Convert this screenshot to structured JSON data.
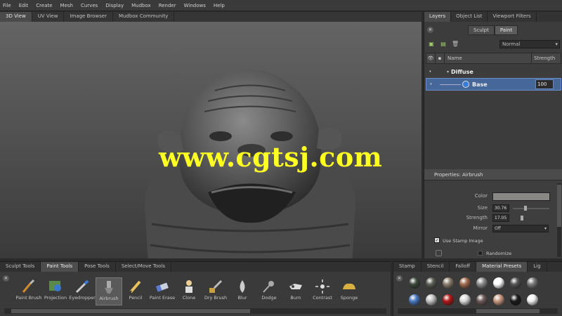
{
  "menu": [
    "File",
    "Edit",
    "Create",
    "Mesh",
    "Curves",
    "Display",
    "Mudbox",
    "Render",
    "Windows",
    "Help"
  ],
  "viewport_tabs": [
    {
      "label": "3D View",
      "active": true
    },
    {
      "label": "UV View",
      "active": false
    },
    {
      "label": "Image Browser",
      "active": false
    },
    {
      "label": "Mudbox Community",
      "active": false
    }
  ],
  "watermark": "www.cgtsj.com",
  "right_tabs": [
    {
      "label": "Layers",
      "active": true
    },
    {
      "label": "Object List",
      "active": false
    },
    {
      "label": "Viewport Filters",
      "active": false
    }
  ],
  "layer_mode": {
    "sculpt": "Sculpt",
    "paint": "Paint",
    "active": "paint"
  },
  "blend_mode": "Normal",
  "layer_header": {
    "name": "Name",
    "strength": "Strength"
  },
  "layers": {
    "group": "Diffuse",
    "layer": "Base",
    "strength": "100"
  },
  "properties": {
    "title": "Properties: Airbrush",
    "color_label": "Color",
    "color_value": "#8a8884",
    "size_label": "Size",
    "size_value": "30.76",
    "strength_label": "Strength",
    "strength_value": "17.05",
    "mirror_label": "Mirror",
    "mirror_value": "Off",
    "stamp_label": "Use Stamp Image",
    "randomize_label": "Randomize"
  },
  "tool_tabs": [
    {
      "label": "Sculpt Tools",
      "active": false
    },
    {
      "label": "Paint Tools",
      "active": true
    },
    {
      "label": "Pose Tools",
      "active": false
    },
    {
      "label": "Select/Move Tools",
      "active": false
    }
  ],
  "tools": [
    {
      "label": "Paint Brush",
      "icon": "paint-brush-icon"
    },
    {
      "label": "Projection",
      "icon": "projection-icon"
    },
    {
      "label": "Eyedropper",
      "icon": "eyedropper-icon"
    },
    {
      "label": "Airbrush",
      "icon": "airbrush-icon",
      "selected": true
    },
    {
      "label": "Pencil",
      "icon": "pencil-icon"
    },
    {
      "label": "Paint Erase",
      "icon": "paint-erase-icon"
    },
    {
      "label": "Clone",
      "icon": "clone-icon"
    },
    {
      "label": "Dry Brush",
      "icon": "dry-brush-icon"
    },
    {
      "label": "Blur",
      "icon": "blur-icon"
    },
    {
      "label": "Dodge",
      "icon": "dodge-icon"
    },
    {
      "label": "Burn",
      "icon": "burn-icon"
    },
    {
      "label": "Contrast",
      "icon": "contrast-icon"
    },
    {
      "label": "Sponge",
      "icon": "sponge-icon"
    }
  ],
  "stamp_tabs": [
    {
      "label": "Stamp",
      "active": false
    },
    {
      "label": "Stencil",
      "active": false
    },
    {
      "label": "Falloff",
      "active": false
    },
    {
      "label": "Material Presets",
      "active": true
    },
    {
      "label": "Lig",
      "active": false
    }
  ],
  "materials_row1": [
    "#3e4a3c",
    "#5a5e55",
    "#8a7e6c",
    "#a06a4e",
    "#8c8c8c",
    "#ffffff",
    "#555555",
    "#7a7a7a"
  ],
  "materials_row2": [
    "#4a78c0",
    "#c0c0c0",
    "#b01818",
    "#d8d8d8",
    "#6e5a5a",
    "#c89880",
    "#1a1a1a",
    "#f0f0f0"
  ]
}
